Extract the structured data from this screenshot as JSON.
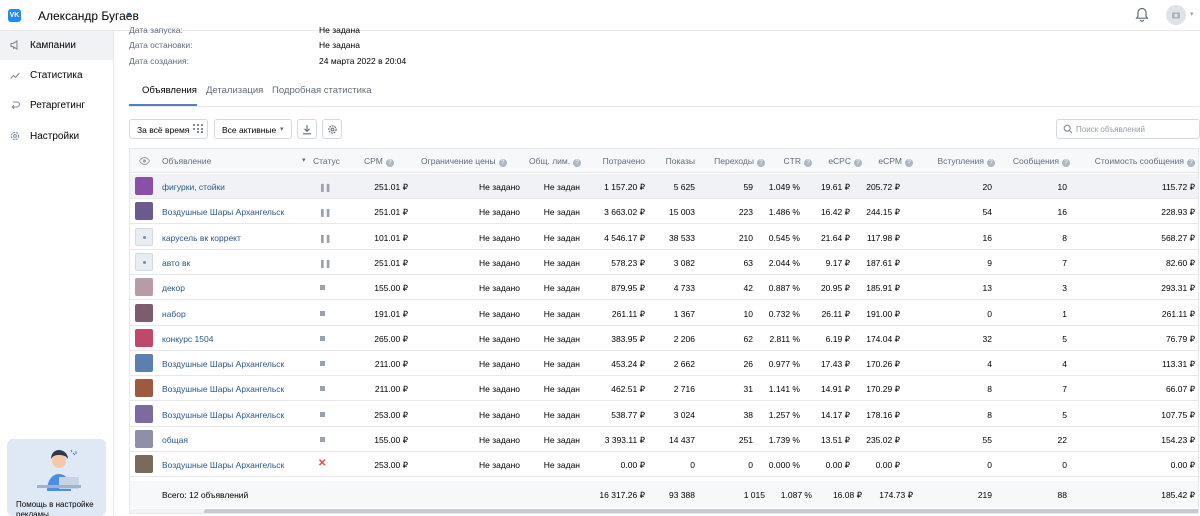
{
  "header": {
    "logo": "VK",
    "user_name": "Александр Бугаев"
  },
  "sidebar": {
    "items": [
      {
        "label": "Кампании",
        "icon": "megaphone-icon",
        "active": true
      },
      {
        "label": "Статистика",
        "icon": "chart-icon",
        "active": false
      },
      {
        "label": "Ретаргетинг",
        "icon": "retarget-icon",
        "active": false
      },
      {
        "label": "Настройки",
        "icon": "gear-icon",
        "active": false
      }
    ],
    "help_text": "Помощь в настройке рекламы"
  },
  "campaign_info": [
    {
      "label": "Дата запуска:",
      "value": "Не задана"
    },
    {
      "label": "Дата остановки:",
      "value": "Не задана"
    },
    {
      "label": "Дата создания:",
      "value": "24 марта 2022 в 20:04"
    }
  ],
  "tabs": [
    {
      "label": "Объявления",
      "active": true
    },
    {
      "label": "Детализация",
      "active": false
    },
    {
      "label": "Подробная статистика",
      "active": false
    }
  ],
  "toolbar": {
    "period_label": "За всё время",
    "filter_label": "Все активные",
    "search_placeholder": "Поиск объявлений"
  },
  "table": {
    "columns": [
      "Объявление",
      "Статус",
      "CPM",
      "Ограничение цены",
      "Общ. лим.",
      "Потрачено",
      "Показы",
      "Переходы",
      "CTR",
      "eCPC",
      "eCPM",
      "Вступления",
      "Сообщения",
      "Стоимость сообщения"
    ],
    "rows": [
      {
        "name": "фигурки, стойки",
        "status": "paused",
        "cpm": "251.01 ₽",
        "price_limit": "Не задано",
        "total_limit": "Не задан",
        "spent": "1 157.20 ₽",
        "impressions": "5 625",
        "clicks": "59",
        "ctr": "1.049 %",
        "ecpc": "19.61 ₽",
        "ecpm": "205.72 ₽",
        "joins": "20",
        "messages": "10",
        "msg_cost": "115.72 ₽",
        "thumb": "#8a4fa8"
      },
      {
        "name": "Воздушные Шары Архангельск",
        "status": "paused",
        "cpm": "251.01 ₽",
        "price_limit": "Не задано",
        "total_limit": "Не задан",
        "spent": "3 663.02 ₽",
        "impressions": "15 003",
        "clicks": "223",
        "ctr": "1.486 %",
        "ecpc": "16.42 ₽",
        "ecpm": "244.15 ₽",
        "joins": "54",
        "messages": "16",
        "msg_cost": "228.93 ₽",
        "thumb": "#6b5a8e"
      },
      {
        "name": "карусель вк коррект",
        "status": "paused",
        "cpm": "101.01 ₽",
        "price_limit": "Не задано",
        "total_limit": "Не задан",
        "spent": "4 546.17 ₽",
        "impressions": "38 533",
        "clicks": "210",
        "ctr": "0.545 %",
        "ecpc": "21.64 ₽",
        "ecpm": "117.98 ₽",
        "joins": "16",
        "messages": "8",
        "msg_cost": "568.27 ₽",
        "thumb": "#e8edf4"
      },
      {
        "name": "авто вк",
        "status": "paused",
        "cpm": "251.01 ₽",
        "price_limit": "Не задано",
        "total_limit": "Не задан",
        "spent": "578.23 ₽",
        "impressions": "3 082",
        "clicks": "63",
        "ctr": "2.044 %",
        "ecpc": "9.17 ₽",
        "ecpm": "187.61 ₽",
        "joins": "9",
        "messages": "7",
        "msg_cost": "82.60 ₽",
        "thumb": "#e8edf4"
      },
      {
        "name": "декор",
        "status": "stopped",
        "cpm": "155.00 ₽",
        "price_limit": "Не задано",
        "total_limit": "Не задан",
        "spent": "879.95 ₽",
        "impressions": "4 733",
        "clicks": "42",
        "ctr": "0.887 %",
        "ecpc": "20.95 ₽",
        "ecpm": "185.91 ₽",
        "joins": "13",
        "messages": "3",
        "msg_cost": "293.31 ₽",
        "thumb": "#b89aa8"
      },
      {
        "name": "набор",
        "status": "stopped",
        "cpm": "191.01 ₽",
        "price_limit": "Не задано",
        "total_limit": "Не задан",
        "spent": "261.11 ₽",
        "impressions": "1 367",
        "clicks": "10",
        "ctr": "0.732 %",
        "ecpc": "26.11 ₽",
        "ecpm": "191.00 ₽",
        "joins": "0",
        "messages": "1",
        "msg_cost": "261.11 ₽",
        "thumb": "#7c5c6e"
      },
      {
        "name": "конкурс 1504",
        "status": "stopped",
        "cpm": "265.00 ₽",
        "price_limit": "Не задано",
        "total_limit": "Не задан",
        "spent": "383.95 ₽",
        "impressions": "2 206",
        "clicks": "62",
        "ctr": "2.811 %",
        "ecpc": "6.19 ₽",
        "ecpm": "174.04 ₽",
        "joins": "32",
        "messages": "5",
        "msg_cost": "76.79 ₽",
        "thumb": "#c0486a"
      },
      {
        "name": "Воздушные Шары Архангельск",
        "status": "stopped",
        "cpm": "211.00 ₽",
        "price_limit": "Не задано",
        "total_limit": "Не задан",
        "spent": "453.24 ₽",
        "impressions": "2 662",
        "clicks": "26",
        "ctr": "0.977 %",
        "ecpc": "17.43 ₽",
        "ecpm": "170.26 ₽",
        "joins": "4",
        "messages": "4",
        "msg_cost": "113.31 ₽",
        "thumb": "#5a7fb0"
      },
      {
        "name": "Воздушные Шары Архангельск",
        "status": "stopped",
        "cpm": "211.00 ₽",
        "price_limit": "Не задано",
        "total_limit": "Не задан",
        "spent": "462.51 ₽",
        "impressions": "2 716",
        "clicks": "31",
        "ctr": "1.141 %",
        "ecpc": "14.91 ₽",
        "ecpm": "170.29 ₽",
        "joins": "8",
        "messages": "7",
        "msg_cost": "66.07 ₽",
        "thumb": "#9e5a3e"
      },
      {
        "name": "Воздушные Шары Архангельск",
        "status": "stopped",
        "cpm": "253.00 ₽",
        "price_limit": "Не задано",
        "total_limit": "Не задан",
        "spent": "538.77 ₽",
        "impressions": "3 024",
        "clicks": "38",
        "ctr": "1.257 %",
        "ecpc": "14.17 ₽",
        "ecpm": "178.16 ₽",
        "joins": "8",
        "messages": "5",
        "msg_cost": "107.75 ₽",
        "thumb": "#7d6a9e"
      },
      {
        "name": "общая",
        "status": "stopped",
        "cpm": "155.00 ₽",
        "price_limit": "Не задано",
        "total_limit": "Не задан",
        "spent": "3 393.11 ₽",
        "impressions": "14 437",
        "clicks": "251",
        "ctr": "1.739 %",
        "ecpc": "13.51 ₽",
        "ecpm": "235.02 ₽",
        "joins": "55",
        "messages": "22",
        "msg_cost": "154.23 ₽",
        "thumb": "#8f8fa8"
      },
      {
        "name": "Воздушные Шары Архангельск",
        "status": "rejected",
        "cpm": "253.00 ₽",
        "price_limit": "Не задано",
        "total_limit": "Не задан",
        "spent": "0.00 ₽",
        "impressions": "0",
        "clicks": "0",
        "ctr": "0.000 %",
        "ecpc": "0.00 ₽",
        "ecpm": "0.00 ₽",
        "joins": "0",
        "messages": "0",
        "msg_cost": "0.00 ₽",
        "thumb": "#7a6a5a"
      }
    ],
    "totals": {
      "label": "Всего: 12 объявлений",
      "spent": "16 317.26 ₽",
      "impressions": "93 388",
      "clicks": "1 015",
      "ctr": "1.087 %",
      "ecpc": "16.08 ₽",
      "ecpm": "174.73 ₽",
      "joins": "219",
      "messages": "88",
      "msg_cost": "185.42 ₽"
    }
  },
  "colors": {
    "link": "#2a5885",
    "accent": "#5181b8",
    "reject": "#e64646",
    "header_bg": "#f7f8fa"
  }
}
